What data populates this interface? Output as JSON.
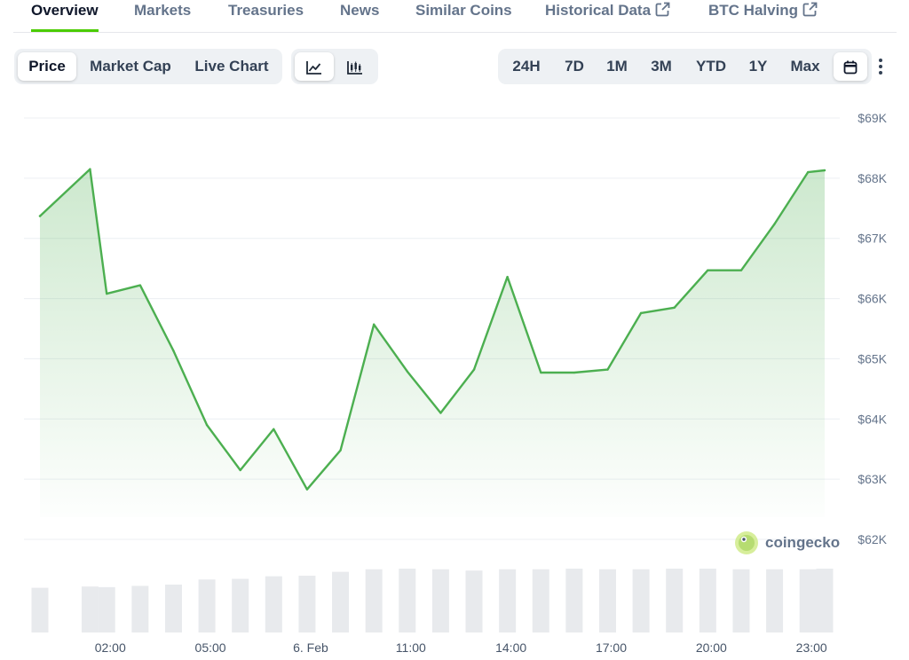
{
  "nav": {
    "tabs": [
      {
        "label": "Overview",
        "active": true
      },
      {
        "label": "Markets"
      },
      {
        "label": "Treasuries"
      },
      {
        "label": "News"
      },
      {
        "label": "Similar Coins"
      },
      {
        "label": "Historical Data",
        "external": true
      },
      {
        "label": "BTC Halving",
        "external": true
      }
    ]
  },
  "metric_toggle": {
    "options": [
      "Price",
      "Market Cap",
      "Live Chart"
    ],
    "selected": "Price"
  },
  "chart_style_toggle": {
    "options": [
      "line-chart-icon",
      "candlestick-icon"
    ],
    "selected": "line-chart-icon"
  },
  "range_toggle": {
    "options": [
      "24H",
      "7D",
      "1M",
      "3M",
      "YTD",
      "1Y",
      "Max"
    ],
    "icons": [
      "calendar-icon",
      "more-vert-icon"
    ]
  },
  "watermark": "coingecko",
  "colors": {
    "line": "#4caf50",
    "fill": "#4caf50",
    "accent": "#4bcc00",
    "volume": "#e8eaed"
  },
  "chart_data": {
    "type": "line",
    "title": "",
    "y_ticks": [
      "$69K",
      "$68K",
      "$67K",
      "$66K",
      "$65K",
      "$64K",
      "$63K",
      "$62K"
    ],
    "ylim": [
      62000,
      69000
    ],
    "x_ticks": [
      "02:00",
      "05:00",
      "6. Feb",
      "11:00",
      "14:00",
      "17:00",
      "20:00",
      "23:00"
    ],
    "x_tick_hours": [
      2,
      5,
      8,
      11,
      14,
      17,
      20,
      23
    ],
    "x_hours": [
      0.0,
      1.5,
      2.0,
      3.0,
      4.0,
      5.0,
      6.0,
      7.0,
      8.0,
      9.0,
      10.0,
      11.0,
      12.0,
      13.0,
      14.0,
      15.0,
      16.0,
      17.0,
      18.0,
      19.0,
      20.0,
      21.0,
      22.0,
      23.0,
      23.5
    ],
    "price": [
      67370,
      68150,
      66080,
      66220,
      65130,
      63900,
      63150,
      63830,
      62830,
      63480,
      65570,
      64790,
      64100,
      64820,
      66360,
      64770,
      64770,
      64820,
      65760,
      65850,
      66470,
      66470,
      67240,
      68100,
      68130
    ],
    "volume_relative": [
      0.7,
      0.72,
      0.71,
      0.73,
      0.75,
      0.83,
      0.84,
      0.88,
      0.89,
      0.95,
      0.99,
      1.0,
      0.99,
      0.97,
      0.99,
      0.99,
      1.0,
      0.99,
      0.99,
      1.0,
      1.0,
      0.99,
      0.99,
      0.99,
      1.0
    ]
  }
}
